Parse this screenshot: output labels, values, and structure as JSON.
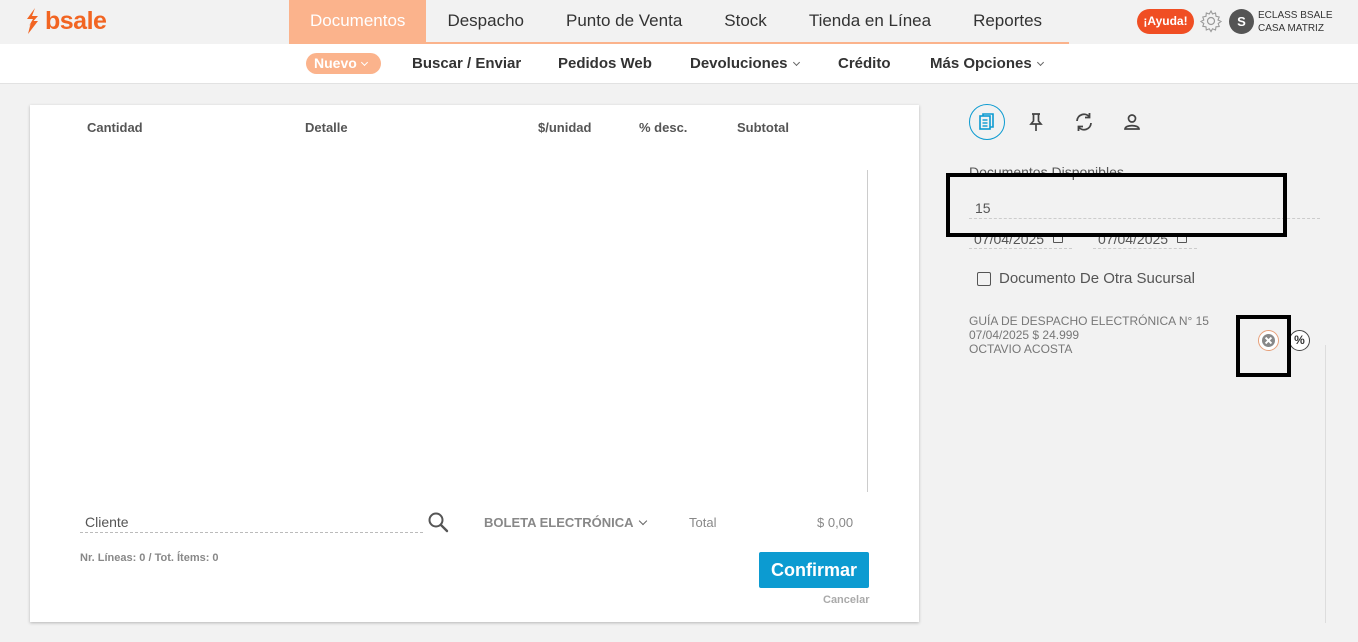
{
  "brand": {
    "name": "bsale",
    "color": "#f26522"
  },
  "main_nav": {
    "items": [
      {
        "label": "Documentos",
        "active": true
      },
      {
        "label": "Despacho",
        "active": false
      },
      {
        "label": "Punto de Venta",
        "active": false
      },
      {
        "label": "Stock",
        "active": false
      },
      {
        "label": "Tienda en Línea",
        "active": false
      },
      {
        "label": "Reportes",
        "active": false
      }
    ],
    "active_color": "#fbb38c"
  },
  "header": {
    "help_label": "¡Ayuda!",
    "settings_icon": "gear-icon",
    "avatar_initial": "S",
    "account_name": "ECLASS BSALE",
    "account_branch": "CASA MATRIZ"
  },
  "sub_nav": {
    "nuevo": "Nuevo",
    "buscar": "Buscar / Enviar",
    "pedidos": "Pedidos Web",
    "devoluciones": "Devoluciones",
    "credito": "Crédito",
    "mas": "Más Opciones"
  },
  "doc_table": {
    "columns": [
      "Cantidad",
      "Detalle",
      "$/unidad",
      "% desc.",
      "Subtotal"
    ],
    "rows": []
  },
  "footer": {
    "client_placeholder": "Cliente",
    "doc_type": "BOLETA ELECTRÓNICA",
    "total_label": "Total",
    "total_value": "$ 0,00",
    "lines_count": "Nr. Líneas: 0 / Tot. Ítems: 0",
    "confirm_label": "Confirmar",
    "cancel_label": "Cancelar"
  },
  "side": {
    "tabs": [
      {
        "icon": "documents-icon",
        "active": true
      },
      {
        "icon": "pin-icon",
        "active": false
      },
      {
        "icon": "sync-icon",
        "active": false
      },
      {
        "icon": "user-icon",
        "active": false
      }
    ],
    "available_label": "Documentos Disponibles",
    "available_value": "15",
    "date_from": "07/04/2025",
    "date_to": "07/04/2025",
    "other_branch_label": "Documento De Otra Sucursal",
    "documents": [
      {
        "title": "GUÍA DE DESPACHO ELECTRÓNICA N° 15",
        "date_amount": "07/04/2025 $ 24.999",
        "client": "OCTAVIO ACOSTA"
      }
    ],
    "percent_label": "%"
  },
  "colors": {
    "accent": "#0c9bd1",
    "help": "#f04e23"
  }
}
